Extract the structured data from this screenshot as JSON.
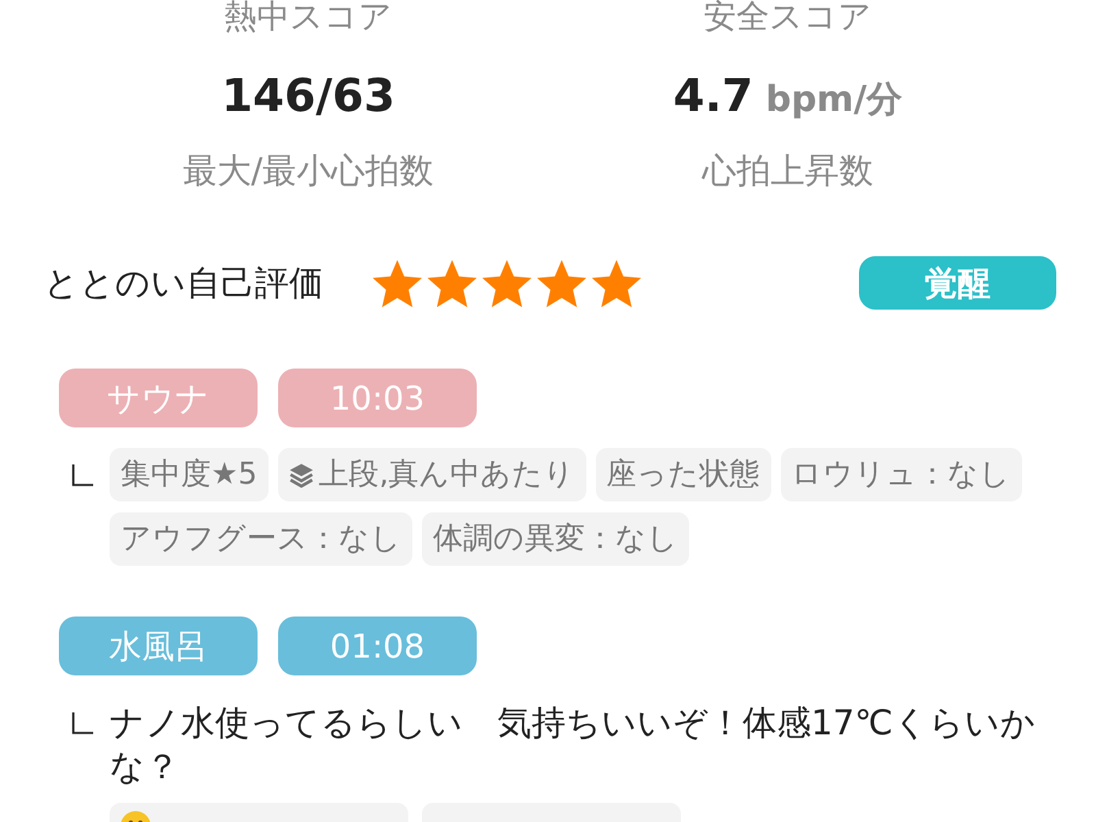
{
  "score_labels": [
    "熱中スコア",
    "安全スコア"
  ],
  "stats": [
    {
      "value": "146/63",
      "label": "最大/最小心拍数"
    },
    {
      "value": "4.7",
      "unit": "bpm/分",
      "label": "心拍上昇数"
    }
  ],
  "self_rating": {
    "label": "ととのい自己評価",
    "stars": 5,
    "mood": "覚醒"
  },
  "sessions": [
    {
      "name": "サウナ",
      "duration": "10:03",
      "color": "#ecb1b5",
      "tags": [
        {
          "kind": "tag",
          "text": "集中度★5"
        },
        {
          "kind": "tier",
          "text": "上段,真ん中あたり"
        },
        {
          "kind": "tag",
          "text": "座った状態"
        },
        {
          "kind": "tag",
          "text": "ロウリュ：なし"
        },
        {
          "kind": "tag",
          "text": "アウフグース：なし"
        },
        {
          "kind": "tag",
          "text": "体調の異変：なし"
        }
      ]
    },
    {
      "name": "水風呂",
      "duration": "01:08",
      "color": "#68bedb",
      "comment": "ナノ水使ってるらしい　気持ちいいぞ！体感17℃くらいかな？",
      "tags": [
        {
          "kind": "mood"
        },
        {
          "kind": "tag"
        }
      ]
    }
  ]
}
